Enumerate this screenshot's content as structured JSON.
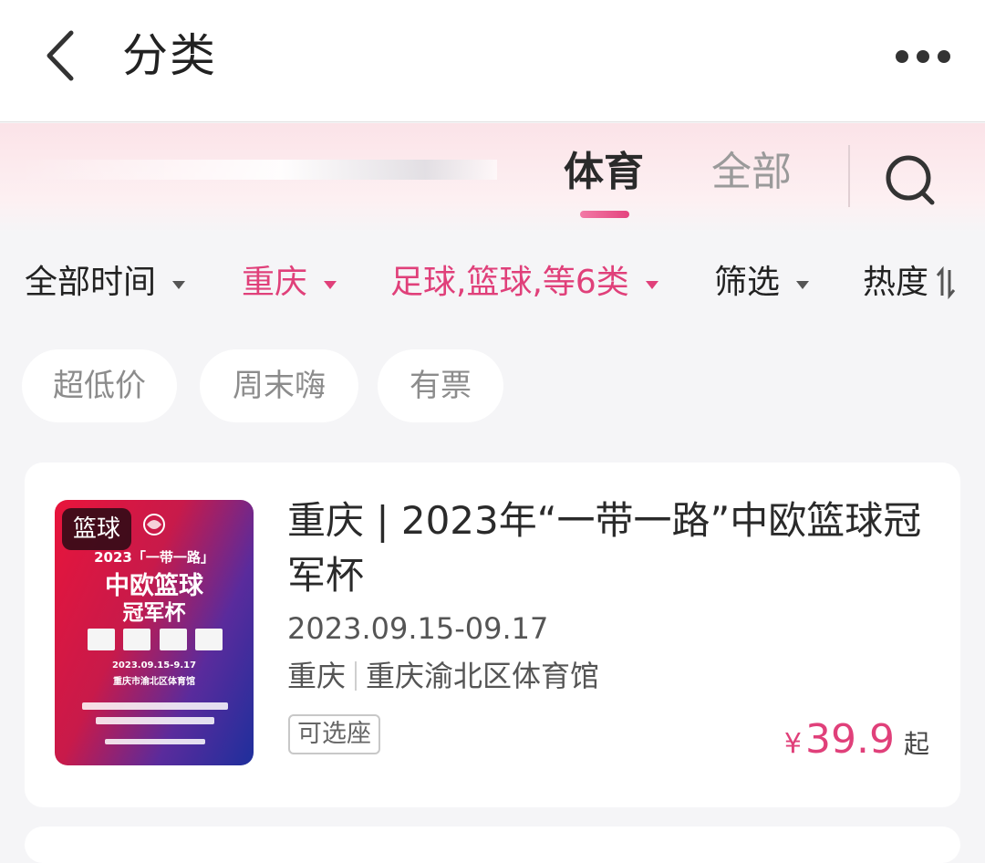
{
  "header": {
    "title": "分类",
    "back_icon": "chevron-left-icon",
    "more_icon": "more-dots-icon"
  },
  "tabs": {
    "items": [
      {
        "label": "体育",
        "active": true
      },
      {
        "label": "全部",
        "active": false
      }
    ],
    "search_icon": "search-icon",
    "accent": "#e4437e"
  },
  "filters": {
    "time": "全部时间",
    "city": "重庆",
    "category": "足球,篮球,等6类",
    "screen": "筛选",
    "sort": "热度"
  },
  "chips": [
    "超低价",
    "周末嗨",
    "有票"
  ],
  "event": {
    "poster_badge": "篮球",
    "poster_text": {
      "line1": "2023「一带一路」",
      "line2": "中欧篮球",
      "line3": "冠军杯",
      "date": "2023.09.15-9.17",
      "venue": "重庆市渝北区体育馆"
    },
    "title": "重庆 | 2023年“一带一路”中欧篮球冠军杯",
    "date": "2023.09.15-09.17",
    "city": "重庆",
    "venue": "重庆渝北区体育馆",
    "tag": "可选座",
    "price_symbol": "¥",
    "price": "39.9",
    "price_suffix": "起"
  },
  "colors": {
    "accent_pink": "#e0407a",
    "background": "#f5f5f7"
  }
}
